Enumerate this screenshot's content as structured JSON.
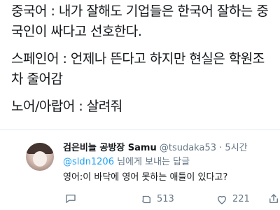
{
  "post": {
    "paragraphs": [
      "중국어 : 내가 잘해도 기업들은 한국어 잘하는 중국인이 싸다고 선호한다.",
      "스페인어 : 언제나 뜬다고 하지만 현실은 학원조차 줄어감",
      "노어/아랍어 : 살려줘"
    ]
  },
  "reply": {
    "author_name": "검은비늘 공방장 Samu",
    "handle": "@tsudaka53",
    "separator": "·",
    "time": "5시간",
    "mention": "@sldn1206",
    "reply_to_suffix": " 님에게 보내는 답글",
    "text": "영어:이 바닥에 영어 못하는 애들이 있다고?",
    "actions": {
      "comment_icon": "comment-icon",
      "retweet_icon": "retweet-icon",
      "retweet_count": "513",
      "like_icon": "heart-icon",
      "like_count": "221",
      "share_icon": "share-icon"
    }
  },
  "colors": {
    "text": "#14171a",
    "muted": "#657786",
    "link": "#1da1f2",
    "divider": "#e6ecf0"
  }
}
